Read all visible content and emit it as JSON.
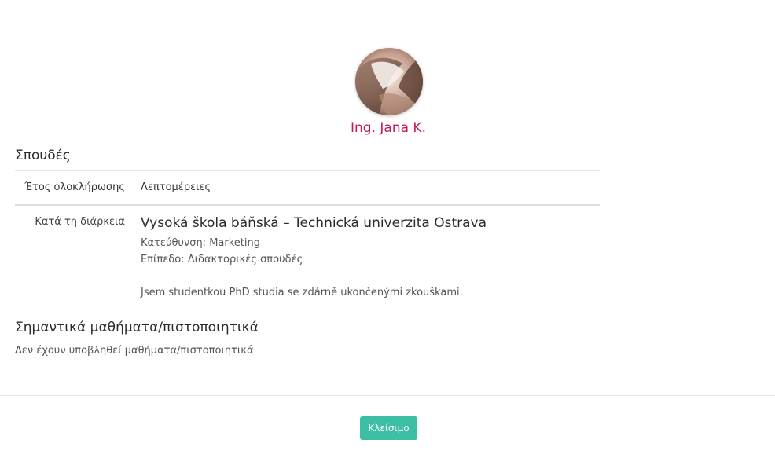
{
  "profile": {
    "name": "Ing. Jana K.",
    "avatar_icon": "profile-photo"
  },
  "studies": {
    "title": "Σπουδές",
    "columns": {
      "year": "Έτος ολοκλήρωσης",
      "details": "Λεπτομέρειες"
    },
    "rows": [
      {
        "year": "Κατά τη διάρκεια",
        "school": "Vysoká škola báňská – Technická univerzita Ostrava",
        "field": "Κατεύθυνση: Marketing",
        "level": "Επίπεδο: Διδακτορικές σπουδές",
        "description": "Jsem studentkou PhD studia se zdárně ukončenými zkouškami."
      }
    ]
  },
  "courses": {
    "title": "Σημαντικά μαθήματα/πιστοποιητικά",
    "empty_text": "Δεν έχουν υποβληθεί μαθήματα/πιστοποιητικά"
  },
  "footer": {
    "close_label": "Κλείσιμο"
  },
  "colors": {
    "name": "#c2185b",
    "button": "#3cbfa5"
  }
}
